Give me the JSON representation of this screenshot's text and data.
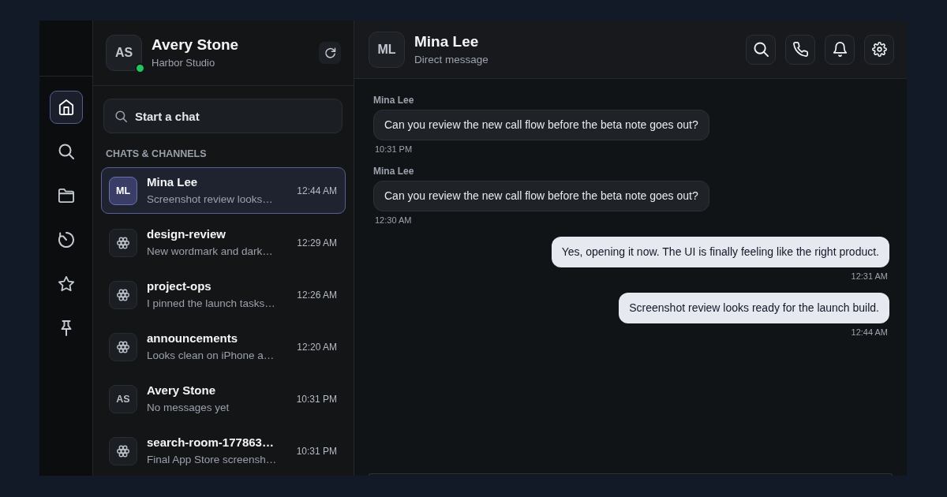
{
  "rail": {
    "items": [
      {
        "kind": "home",
        "selected": true
      },
      {
        "kind": "search",
        "selected": false
      },
      {
        "kind": "folder",
        "selected": false
      },
      {
        "kind": "history",
        "selected": false
      },
      {
        "kind": "star",
        "selected": false
      },
      {
        "kind": "pin",
        "selected": false
      }
    ]
  },
  "profile": {
    "initials": "AS",
    "name": "Avery Stone",
    "subtitle": "Harbor Studio",
    "online": true,
    "actions": [
      {
        "kind": "refresh"
      }
    ]
  },
  "search": {
    "placeholder": "Start a chat"
  },
  "section_title": "CHATS & CHANNELS",
  "conversations": [
    {
      "kind": "person",
      "initials": "ML",
      "name": "Mina Lee",
      "preview": "Screenshot review looks…",
      "time": "12:44 AM",
      "selected": true
    },
    {
      "kind": "channel",
      "name": "design-review",
      "preview": "New wordmark and dark…",
      "time": "12:29 AM",
      "selected": false
    },
    {
      "kind": "channel",
      "name": "project-ops",
      "preview": "I pinned the launch tasks…",
      "time": "12:26 AM",
      "selected": false
    },
    {
      "kind": "channel",
      "name": "announcements",
      "preview": "Looks clean on iPhone a…",
      "time": "12:20 AM",
      "selected": false
    },
    {
      "kind": "person",
      "initials": "AS",
      "name": "Avery Stone",
      "preview": "No messages yet",
      "time": "10:31 PM",
      "selected": false
    },
    {
      "kind": "channel",
      "name": "search-room-177863…",
      "preview": "Final App Store screensh…",
      "time": "10:31 PM",
      "selected": false
    }
  ],
  "chat": {
    "initials": "ML",
    "title": "Mina Lee",
    "subtitle": "Direct message",
    "actions": [
      {
        "kind": "search"
      },
      {
        "kind": "call"
      },
      {
        "kind": "notifications"
      },
      {
        "kind": "settings"
      }
    ]
  },
  "messages": [
    {
      "kind": "incoming",
      "sender": "Mina Lee",
      "text": "Can you review the new call flow before the beta note goes out?",
      "time": "10:31 PM"
    },
    {
      "kind": "incoming",
      "sender": "Mina Lee",
      "text": "Can you review the new call flow before the beta note goes out?",
      "time": "12:30 AM"
    },
    {
      "kind": "outgoing",
      "text": "Yes, opening it now. The UI is finally feeling like the right product.",
      "time": "12:31 AM"
    },
    {
      "kind": "outgoing",
      "text": "Screenshot review looks ready for the launch build.",
      "time": "12:44 AM"
    }
  ]
}
